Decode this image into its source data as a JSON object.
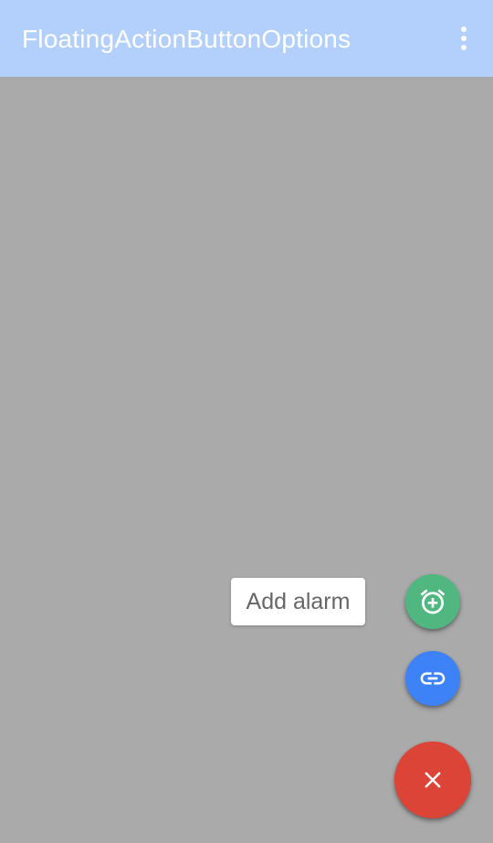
{
  "app_bar": {
    "title": "FloatingActionButtonOptions",
    "overflow_icon": "more-vert-icon"
  },
  "fab_menu": {
    "label": "Add alarm",
    "actions": [
      {
        "icon": "add-alarm-icon",
        "color": "#4fb77f"
      },
      {
        "icon": "link-icon",
        "color": "#3e82f7"
      }
    ],
    "main": {
      "icon": "close-icon",
      "color": "#db4437"
    }
  },
  "colors": {
    "app_bar": "#b2d0fb",
    "scrim": "#aaaaaa"
  }
}
